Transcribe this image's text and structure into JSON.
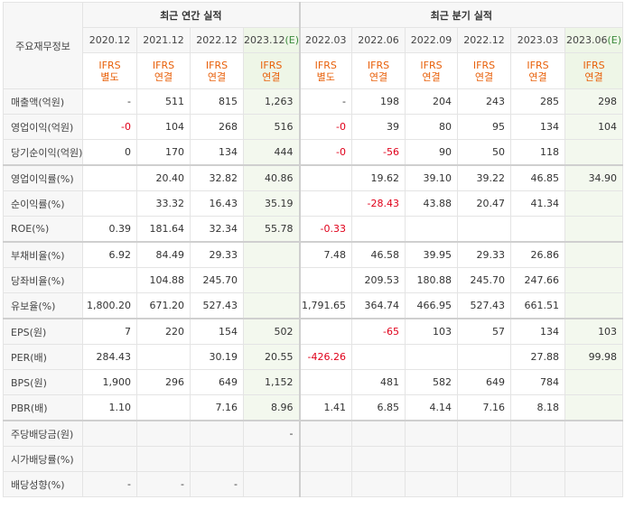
{
  "headers": {
    "corner": "주요재무정보",
    "annual_group": "최근 연간 실적",
    "quarterly_group": "최근 분기 실적",
    "periods": [
      {
        "label": "2020.12",
        "estimate": ""
      },
      {
        "label": "2021.12",
        "estimate": ""
      },
      {
        "label": "2022.12",
        "estimate": ""
      },
      {
        "label": "2023.12",
        "estimate": "(E)"
      },
      {
        "label": "2022.03",
        "estimate": ""
      },
      {
        "label": "2022.06",
        "estimate": ""
      },
      {
        "label": "2022.09",
        "estimate": ""
      },
      {
        "label": "2022.12",
        "estimate": ""
      },
      {
        "label": "2023.03",
        "estimate": ""
      },
      {
        "label": "2023.06",
        "estimate": "(E)"
      }
    ],
    "types": [
      [
        "IFRS",
        "별도"
      ],
      [
        "IFRS",
        "연결"
      ],
      [
        "IFRS",
        "연결"
      ],
      [
        "IFRS",
        "연결"
      ],
      [
        "IFRS",
        "별도"
      ],
      [
        "IFRS",
        "연결"
      ],
      [
        "IFRS",
        "연결"
      ],
      [
        "IFRS",
        "연결"
      ],
      [
        "IFRS",
        "연결"
      ],
      [
        "IFRS",
        "연결"
      ]
    ]
  },
  "rows": [
    {
      "label": "매출액(억원)",
      "values": [
        "-",
        "511",
        "815",
        "1,263",
        "-",
        "198",
        "204",
        "243",
        "285",
        "298"
      ],
      "negatives": []
    },
    {
      "label": "영업이익(억원)",
      "values": [
        "-0",
        "104",
        "268",
        "516",
        "-0",
        "39",
        "80",
        "95",
        "134",
        "104"
      ],
      "negatives": [
        0,
        4
      ]
    },
    {
      "label": "당기순이익(억원)",
      "values": [
        "0",
        "170",
        "134",
        "444",
        "-0",
        "-56",
        "90",
        "50",
        "118",
        ""
      ],
      "negatives": [
        4,
        5
      ]
    },
    {
      "label": "영업이익률(%)",
      "values": [
        "",
        "20.40",
        "32.82",
        "40.86",
        "",
        "19.62",
        "39.10",
        "39.22",
        "46.85",
        "34.90"
      ],
      "negatives": []
    },
    {
      "label": "순이익률(%)",
      "values": [
        "",
        "33.32",
        "16.43",
        "35.19",
        "",
        "-28.43",
        "43.88",
        "20.47",
        "41.34",
        ""
      ],
      "negatives": [
        5
      ]
    },
    {
      "label": "ROE(%)",
      "values": [
        "0.39",
        "181.64",
        "32.34",
        "55.78",
        "-0.33",
        "",
        "",
        "",
        "",
        ""
      ],
      "negatives": [
        4
      ]
    },
    {
      "label": "부채비율(%)",
      "values": [
        "6.92",
        "84.49",
        "29.33",
        "",
        "7.48",
        "46.58",
        "39.95",
        "29.33",
        "26.86",
        ""
      ],
      "negatives": []
    },
    {
      "label": "당좌비율(%)",
      "values": [
        "",
        "104.88",
        "245.70",
        "",
        "",
        "209.53",
        "180.88",
        "245.70",
        "247.66",
        ""
      ],
      "negatives": []
    },
    {
      "label": "유보율(%)",
      "values": [
        "1,800.20",
        "671.20",
        "527.43",
        "",
        "1,791.65",
        "364.74",
        "466.95",
        "527.43",
        "661.51",
        ""
      ],
      "negatives": []
    },
    {
      "label": "EPS(원)",
      "values": [
        "7",
        "220",
        "154",
        "502",
        "",
        "-65",
        "103",
        "57",
        "134",
        "103"
      ],
      "negatives": [
        5
      ]
    },
    {
      "label": "PER(배)",
      "values": [
        "284.43",
        "",
        "30.19",
        "20.55",
        "-426.26",
        "",
        "",
        "",
        "27.88",
        "99.98"
      ],
      "negatives": [
        4
      ]
    },
    {
      "label": "BPS(원)",
      "values": [
        "1,900",
        "296",
        "649",
        "1,152",
        "",
        "481",
        "582",
        "649",
        "784",
        ""
      ],
      "negatives": []
    },
    {
      "label": "PBR(배)",
      "values": [
        "1.10",
        "",
        "7.16",
        "8.96",
        "1.41",
        "6.85",
        "4.14",
        "7.16",
        "8.18",
        ""
      ],
      "negatives": []
    },
    {
      "label": "주당배당금(원)",
      "values": [
        "",
        "",
        "",
        "-",
        "",
        "",
        "",
        "",
        "",
        ""
      ],
      "negatives": []
    },
    {
      "label": "시가배당률(%)",
      "values": [
        "",
        "",
        "",
        "",
        "",
        "",
        "",
        "",
        "",
        ""
      ],
      "negatives": []
    },
    {
      "label": "배당성향(%)",
      "values": [
        "-",
        "-",
        "-",
        "",
        "",
        "",
        "",
        "",
        "",
        ""
      ],
      "negatives": []
    }
  ],
  "colors": {
    "negative": "#e0001a",
    "type_label": "#e8600a",
    "estimate_bg": "#f3f8ee",
    "header_bg": "#f7f7f7"
  }
}
